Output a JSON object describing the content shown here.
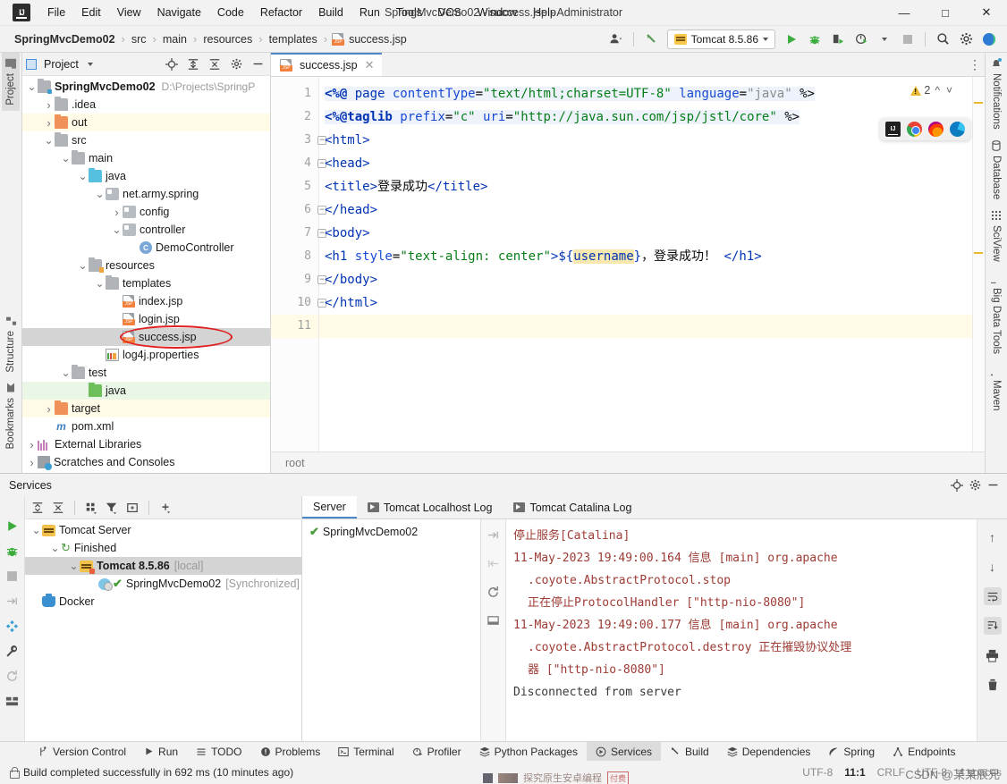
{
  "window": {
    "title": "SpringMvcDemo02 - success.jsp - Administrator",
    "minimize": "—",
    "maximize": "□",
    "close": "✕"
  },
  "menubar": {
    "items": [
      "File",
      "Edit",
      "View",
      "Navigate",
      "Code",
      "Refactor",
      "Build",
      "Run",
      "Tools",
      "VCS",
      "Window",
      "Help"
    ]
  },
  "breadcrumbs": {
    "project": "SpringMvcDemo02",
    "items": [
      "src",
      "main",
      "resources",
      "templates"
    ],
    "file": "success.jsp",
    "separator": "›"
  },
  "toolbar": {
    "run_config": "Tomcat 8.5.86",
    "run_tooltip": "Run",
    "debug_tooltip": "Debug",
    "stop_tooltip": "Stop"
  },
  "left_strip": {
    "tabs": [
      "Project",
      "Structure",
      "Bookmarks"
    ]
  },
  "right_strip": {
    "tabs": [
      "Notifications",
      "Database",
      "SciView",
      "Big Data Tools",
      "Maven"
    ]
  },
  "project_panel": {
    "title": "Project",
    "tree": [
      {
        "label": "SpringMvcDemo02",
        "path": "D:\\Projects\\SpringP",
        "depth": 0,
        "arrow": "v",
        "icon": "project-folder",
        "bold": true,
        "hl": ""
      },
      {
        "label": ".idea",
        "path": "",
        "depth": 1,
        "arrow": ">",
        "icon": "folder",
        "bold": false,
        "hl": ""
      },
      {
        "label": "out",
        "path": "",
        "depth": 1,
        "arrow": ">",
        "icon": "folder-orange",
        "bold": false,
        "hl": "yellow"
      },
      {
        "label": "src",
        "path": "",
        "depth": 1,
        "arrow": "v",
        "icon": "folder",
        "bold": false,
        "hl": ""
      },
      {
        "label": "main",
        "path": "",
        "depth": 2,
        "arrow": "v",
        "icon": "folder",
        "bold": false,
        "hl": ""
      },
      {
        "label": "java",
        "path": "",
        "depth": 3,
        "arrow": "v",
        "icon": "folder-blue",
        "bold": false,
        "hl": ""
      },
      {
        "label": "net.army.spring",
        "path": "",
        "depth": 4,
        "arrow": "v",
        "icon": "package",
        "bold": false,
        "hl": ""
      },
      {
        "label": "config",
        "path": "",
        "depth": 5,
        "arrow": ">",
        "icon": "package",
        "bold": false,
        "hl": ""
      },
      {
        "label": "controller",
        "path": "",
        "depth": 5,
        "arrow": "v",
        "icon": "package",
        "bold": false,
        "hl": ""
      },
      {
        "label": "DemoController",
        "path": "",
        "depth": 6,
        "arrow": "",
        "icon": "class",
        "bold": false,
        "hl": ""
      },
      {
        "label": "resources",
        "path": "",
        "depth": 3,
        "arrow": "v",
        "icon": "folder-res",
        "bold": false,
        "hl": ""
      },
      {
        "label": "templates",
        "path": "",
        "depth": 4,
        "arrow": "v",
        "icon": "folder",
        "bold": false,
        "hl": ""
      },
      {
        "label": "index.jsp",
        "path": "",
        "depth": 5,
        "arrow": "",
        "icon": "jsp",
        "bold": false,
        "hl": ""
      },
      {
        "label": "login.jsp",
        "path": "",
        "depth": 5,
        "arrow": "",
        "icon": "jsp",
        "bold": false,
        "hl": ""
      },
      {
        "label": "success.jsp",
        "path": "",
        "depth": 5,
        "arrow": "",
        "icon": "jsp",
        "bold": false,
        "hl": "sel"
      },
      {
        "label": "log4j.properties",
        "path": "",
        "depth": 4,
        "arrow": "",
        "icon": "properties",
        "bold": false,
        "hl": ""
      },
      {
        "label": "test",
        "path": "",
        "depth": 2,
        "arrow": "v",
        "icon": "folder",
        "bold": false,
        "hl": ""
      },
      {
        "label": "java",
        "path": "",
        "depth": 3,
        "arrow": "",
        "icon": "folder-green",
        "bold": false,
        "hl": "green"
      },
      {
        "label": "target",
        "path": "",
        "depth": 1,
        "arrow": ">",
        "icon": "folder-orange",
        "bold": false,
        "hl": "yellow"
      },
      {
        "label": "pom.xml",
        "path": "",
        "depth": 1,
        "arrow": "",
        "icon": "maven",
        "bold": false,
        "hl": ""
      },
      {
        "label": "External Libraries",
        "path": "",
        "depth": 0,
        "arrow": ">",
        "icon": "library",
        "bold": false,
        "hl": ""
      },
      {
        "label": "Scratches and Consoles",
        "path": "",
        "depth": 0,
        "arrow": ">",
        "icon": "scratch",
        "bold": false,
        "hl": ""
      }
    ]
  },
  "editor": {
    "tab_label": "success.jsp",
    "tab_close": "✕",
    "warning_count": "2",
    "breadcrumb": "root",
    "line_numbers": [
      "1",
      "2",
      "3",
      "4",
      "5",
      "6",
      "7",
      "8",
      "9",
      "10",
      "11"
    ],
    "lines": [
      {
        "n": 1,
        "segments": [
          {
            "t": "<%@ ",
            "c": "k-dir"
          },
          {
            "t": "page ",
            "c": "k-tag"
          },
          {
            "t": "contentType",
            "c": "k-attr"
          },
          {
            "t": "=",
            "c": "k-plain"
          },
          {
            "t": "\"text/html;charset=UTF-8\"",
            "c": "k-str"
          },
          {
            "t": " ",
            "c": "k-plain"
          },
          {
            "t": "language",
            "c": "k-attr"
          },
          {
            "t": "=",
            "c": "k-plain"
          },
          {
            "t": "\"java\"",
            "c": "k-gray"
          },
          {
            "t": " %>",
            "c": "k-plain"
          }
        ]
      },
      {
        "n": 2,
        "segments": [
          {
            "t": "<%@taglib ",
            "c": "k-dir"
          },
          {
            "t": "prefix",
            "c": "k-attr"
          },
          {
            "t": "=",
            "c": "k-plain"
          },
          {
            "t": "\"c\"",
            "c": "k-str"
          },
          {
            "t": " ",
            "c": "k-plain"
          },
          {
            "t": "uri",
            "c": "k-attr"
          },
          {
            "t": "=",
            "c": "k-plain"
          },
          {
            "t": "\"http://java.sun.com/jsp/jstl/core\"",
            "c": "k-str"
          },
          {
            "t": " %>",
            "c": "k-plain"
          }
        ]
      },
      {
        "n": 3,
        "segments": [
          {
            "t": "<html>",
            "c": "k-tag"
          }
        ]
      },
      {
        "n": 4,
        "segments": [
          {
            "t": "<head>",
            "c": "k-tag"
          }
        ]
      },
      {
        "n": 5,
        "segments": [
          {
            "t": "    <title>",
            "c": "k-tag"
          },
          {
            "t": "登录成功",
            "c": "k-cn"
          },
          {
            "t": "</title>",
            "c": "k-tag"
          }
        ]
      },
      {
        "n": 6,
        "segments": [
          {
            "t": "</head>",
            "c": "k-tag"
          }
        ]
      },
      {
        "n": 7,
        "segments": [
          {
            "t": "<body>",
            "c": "k-tag"
          }
        ]
      },
      {
        "n": 8,
        "segments": [
          {
            "t": "<h1 ",
            "c": "k-tag"
          },
          {
            "t": "style",
            "c": "k-attr"
          },
          {
            "t": "=",
            "c": "k-plain"
          },
          {
            "t": "\"text-align: center\"",
            "c": "k-str"
          },
          {
            "t": ">",
            "c": "k-tag"
          },
          {
            "t": "${",
            "c": "k-el"
          },
          {
            "t": "username",
            "c": "k-el el-hl"
          },
          {
            "t": "}",
            "c": "k-el"
          },
          {
            "t": "，登录成功！",
            "c": "k-cn"
          },
          {
            "t": " </h1>",
            "c": "k-tag"
          }
        ]
      },
      {
        "n": 9,
        "segments": [
          {
            "t": "</body>",
            "c": "k-tag"
          }
        ]
      },
      {
        "n": 10,
        "segments": [
          {
            "t": "</html>",
            "c": "k-tag"
          }
        ]
      },
      {
        "n": 11,
        "segments": []
      }
    ],
    "browser_popup": [
      "ij-browser-icon",
      "chrome-icon",
      "firefox-icon",
      "edge-icon"
    ]
  },
  "services": {
    "title": "Services",
    "tree": [
      {
        "label": "Tomcat Server",
        "depth": 0,
        "arrow": "v",
        "icon": "tomcat",
        "suffix": "",
        "bold": false,
        "sel": false
      },
      {
        "label": "Finished",
        "depth": 1,
        "arrow": "v",
        "icon": "refresh",
        "suffix": "",
        "bold": false,
        "sel": false
      },
      {
        "label": "Tomcat 8.5.86",
        "depth": 2,
        "arrow": "v",
        "icon": "tomcat-run",
        "suffix": "[local]",
        "bold": true,
        "sel": true
      },
      {
        "label": "SpringMvcDemo02",
        "depth": 3,
        "arrow": "",
        "icon": "deploy-ok",
        "suffix": "[Synchronized]",
        "bold": false,
        "sel": false
      },
      {
        "label": "Docker",
        "depth": 0,
        "arrow": "",
        "icon": "docker",
        "suffix": "",
        "bold": false,
        "sel": false
      }
    ],
    "tabs": [
      {
        "label": "Server",
        "selected": true,
        "icon": ""
      },
      {
        "label": "Tomcat Localhost Log",
        "selected": false,
        "icon": "log-icon"
      },
      {
        "label": "Tomcat Catalina Log",
        "selected": false,
        "icon": "log-icon"
      }
    ],
    "deployment_list": [
      {
        "label": "SpringMvcDemo02",
        "status": "ok"
      }
    ],
    "console_lines": [
      {
        "text": "停止服务[Catalina]",
        "indent": false,
        "dark": false
      },
      {
        "text": "11-May-2023 19:49:00.164 信息 [main] org.apache",
        "indent": false,
        "dark": false
      },
      {
        "text": ".coyote.AbstractProtocol.stop",
        "indent": true,
        "dark": false
      },
      {
        "text": "正在停止ProtocolHandler [\"http-nio-8080\"]",
        "indent": true,
        "dark": false
      },
      {
        "text": "11-May-2023 19:49:00.177 信息 [main] org.apache",
        "indent": false,
        "dark": false
      },
      {
        "text": ".coyote.AbstractProtocol.destroy 正在摧毁协议处理",
        "indent": true,
        "dark": false
      },
      {
        "text": "器 [\"http-nio-8080\"]",
        "indent": true,
        "dark": false
      },
      {
        "text": "Disconnected from server",
        "indent": false,
        "dark": true
      }
    ]
  },
  "tool_strip": {
    "items": [
      {
        "label": "Version Control",
        "icon": "branch-icon",
        "selected": false
      },
      {
        "label": "Run",
        "icon": "play-icon",
        "selected": false
      },
      {
        "label": "TODO",
        "icon": "list-icon",
        "selected": false
      },
      {
        "label": "Problems",
        "icon": "error-icon",
        "selected": false
      },
      {
        "label": "Terminal",
        "icon": "terminal-icon",
        "selected": false
      },
      {
        "label": "Profiler",
        "icon": "profiler-icon",
        "selected": false
      },
      {
        "label": "Python Packages",
        "icon": "packages-icon",
        "selected": false
      },
      {
        "label": "Services",
        "icon": "services-icon",
        "selected": true
      },
      {
        "label": "Build",
        "icon": "hammer-icon",
        "selected": false
      },
      {
        "label": "Dependencies",
        "icon": "layers-icon",
        "selected": false
      },
      {
        "label": "Spring",
        "icon": "leaf-icon",
        "selected": false
      },
      {
        "label": "Endpoints",
        "icon": "endpoints-icon",
        "selected": false
      }
    ]
  },
  "status_bar": {
    "message": "Build completed successfully in 692 ms (10 minutes ago)",
    "encoding": "UTF-8",
    "caret": "11:1",
    "line_sep": "CRLF",
    "file_encoding": "UTF-8",
    "indent": "4 spaces",
    "watermark": "CSDN @某某辰兄"
  }
}
